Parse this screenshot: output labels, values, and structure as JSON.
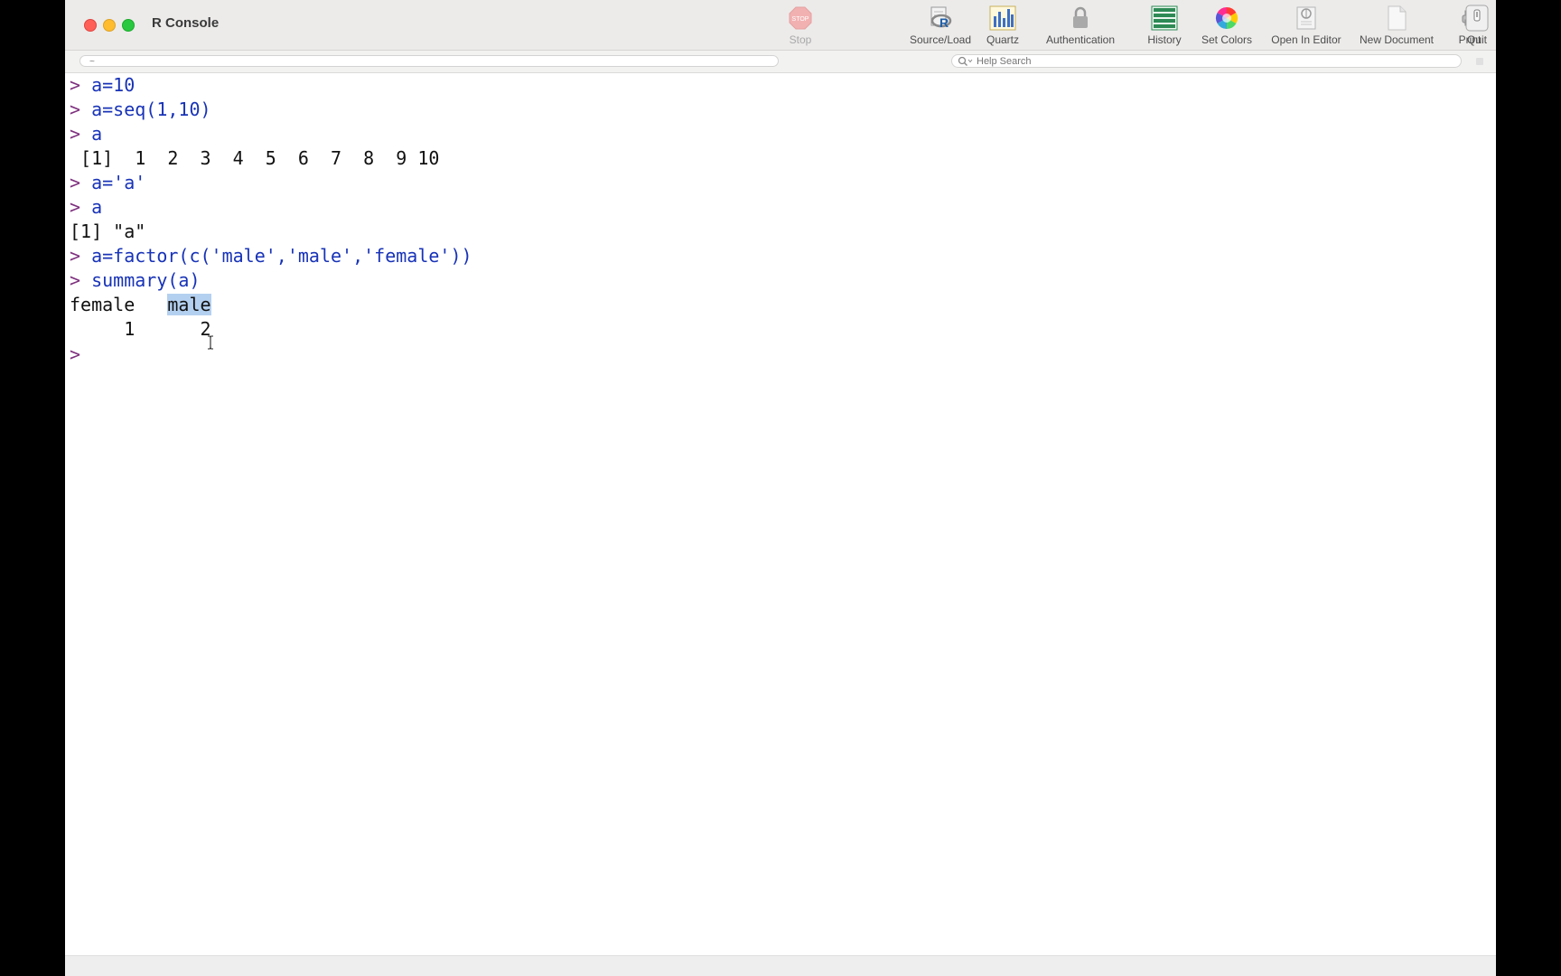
{
  "window": {
    "title": "R Console"
  },
  "toolbar": {
    "stop": "Stop",
    "source_load": "Source/Load",
    "quartz": "Quartz",
    "authentication": "Authentication",
    "history": "History",
    "set_colors": "Set Colors",
    "open_in_editor": "Open In Editor",
    "new_document": "New Document",
    "print": "Print",
    "quit": "Quit",
    "stop_sign_text": "STOP"
  },
  "subbar": {
    "working_dir": "~",
    "help_search_placeholder": "Help Search"
  },
  "console": {
    "prompt": ">",
    "lines": [
      {
        "kind": "cmd",
        "text": "a=10"
      },
      {
        "kind": "cmd",
        "text": "a=seq(1,10)"
      },
      {
        "kind": "cmd",
        "text": "a"
      },
      {
        "kind": "out",
        "text": " [1]  1  2  3  4  5  6  7  8  9 10"
      },
      {
        "kind": "cmd",
        "text": "a='a'"
      },
      {
        "kind": "cmd",
        "text": "a"
      },
      {
        "kind": "out",
        "text": "[1] \"a\""
      },
      {
        "kind": "cmd",
        "text": "a=factor(c('male','male','female'))"
      },
      {
        "kind": "cmd",
        "text": "summary(a)"
      },
      {
        "kind": "out",
        "text_before": "female   ",
        "text_selected": "male"
      },
      {
        "kind": "out",
        "text": "     1      2"
      }
    ]
  },
  "colors": {
    "prompt": "#7e2f7e",
    "command": "#1833b7",
    "output": "#111111",
    "selection": "#b4d0f0"
  }
}
